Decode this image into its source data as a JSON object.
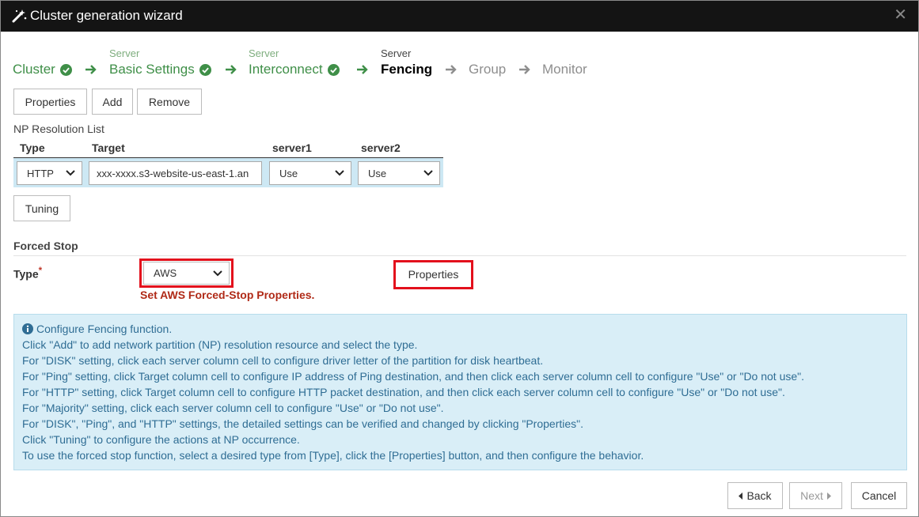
{
  "window": {
    "title": "Cluster generation wizard",
    "close_glyph": "✕"
  },
  "steps": [
    {
      "sub": "",
      "label": "Cluster",
      "state": "done"
    },
    {
      "sub": "Server",
      "label": "Basic Settings",
      "state": "done"
    },
    {
      "sub": "Server",
      "label": "Interconnect",
      "state": "done"
    },
    {
      "sub": "Server",
      "label": "Fencing",
      "state": "active"
    },
    {
      "sub": "",
      "label": "Group",
      "state": "pending"
    },
    {
      "sub": "",
      "label": "Monitor",
      "state": "pending"
    }
  ],
  "toolbar": {
    "properties": "Properties",
    "add": "Add",
    "remove": "Remove"
  },
  "np_list": {
    "title": "NP Resolution List",
    "columns": [
      "Type",
      "Target",
      "server1",
      "server2"
    ],
    "row": {
      "type": "HTTP",
      "target": "xxx-xxxx.s3-website-us-east-1.an",
      "server1": "Use",
      "server2": "Use"
    }
  },
  "tuning_label": "Tuning",
  "forced_stop": {
    "section_title": "Forced Stop",
    "type_label": "Type",
    "required_mark": "*",
    "type_value": "AWS",
    "properties_label": "Properties",
    "warning": "Set AWS Forced-Stop Properties."
  },
  "info": {
    "icon": "info-icon",
    "lines": [
      "Configure Fencing function.",
      "Click \"Add\" to add network partition (NP) resolution resource and select the type.",
      "For \"DISK\" setting, click each server column cell to configure driver letter of the partition for disk heartbeat.",
      "For \"Ping\" setting, click Target column cell to configure IP address of Ping destination, and then click each server column cell to configure \"Use\" or \"Do not use\".",
      "For \"HTTP\" setting, click Target column cell to configure HTTP packet destination, and then click each server column cell to configure \"Use\" or \"Do not use\".",
      "For \"Majority\" setting, click each server column cell to configure \"Use\" or \"Do not use\".",
      "For \"DISK\", \"Ping\", and \"HTTP\" settings, the detailed settings can be verified and changed by clicking \"Properties\".",
      "Click \"Tuning\" to configure the actions at NP occurrence.",
      "To use the forced stop function, select a desired type from [Type], click the [Properties] button, and then configure the behavior."
    ]
  },
  "footer": {
    "back": "Back",
    "next": "Next",
    "cancel": "Cancel"
  },
  "colors": {
    "title_bg": "#141414",
    "step_done": "#3f8f48",
    "highlight": "#e3101c",
    "info_bg": "#d9eef7",
    "info_text": "#2f6d94"
  }
}
